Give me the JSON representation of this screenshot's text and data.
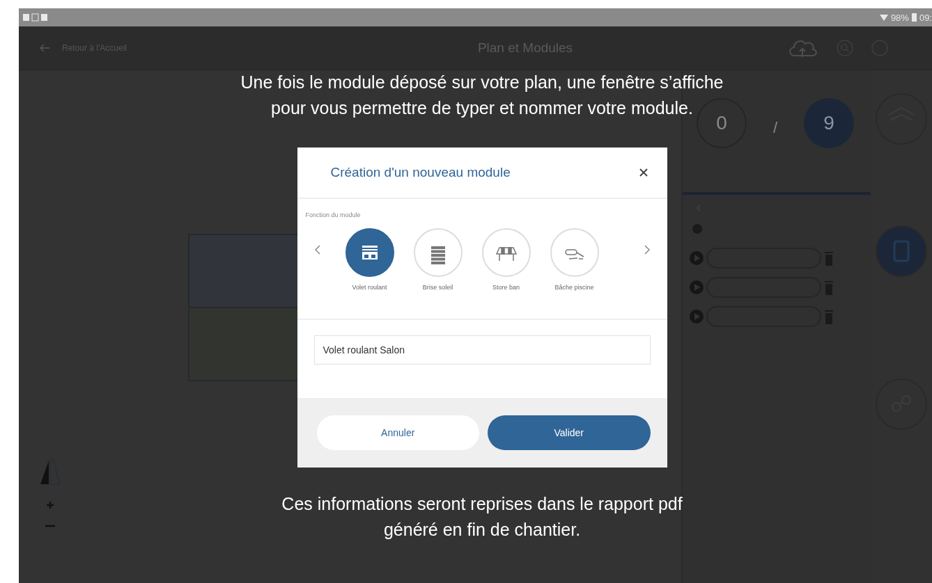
{
  "status_bar": {
    "battery": "98%",
    "time": "09:"
  },
  "app_bar": {
    "back_label": "Retour à l'Accueil",
    "title": "Plan et Modules"
  },
  "sidebar": {
    "placed_count": "0",
    "separator": "/",
    "scanned_count": "9"
  },
  "rail": [
    {
      "selected": false,
      "kind": "plan"
    },
    {
      "selected": true,
      "kind": "modules"
    },
    {
      "selected": false,
      "kind": "connection"
    }
  ],
  "tutorial": {
    "top_lines": [
      "Une fois le module déposé sur votre plan, une fenêtre s’affiche",
      "pour vous permettre de typer et nommer votre module."
    ],
    "bottom_lines": [
      "Ces informations seront reprises dans le rapport pdf",
      "généré en fin de chantier."
    ]
  },
  "dialog": {
    "title": "Création d'un nouveau module",
    "section_label": "Fonction du module",
    "functions": [
      {
        "label": "Volet roulant",
        "selected": true,
        "kind": "roller-shutter"
      },
      {
        "label": "Brise soleil",
        "selected": false,
        "kind": "sun-breaker"
      },
      {
        "label": "Store ban",
        "selected": false,
        "kind": "awning"
      },
      {
        "label": "Bâche piscine",
        "selected": false,
        "kind": "pool-cover"
      }
    ],
    "name_value": "Volet roulant Salon",
    "buttons": [
      {
        "label": "Annuler",
        "kind": "secondary"
      },
      {
        "label": "Valider",
        "kind": "primary"
      }
    ]
  }
}
